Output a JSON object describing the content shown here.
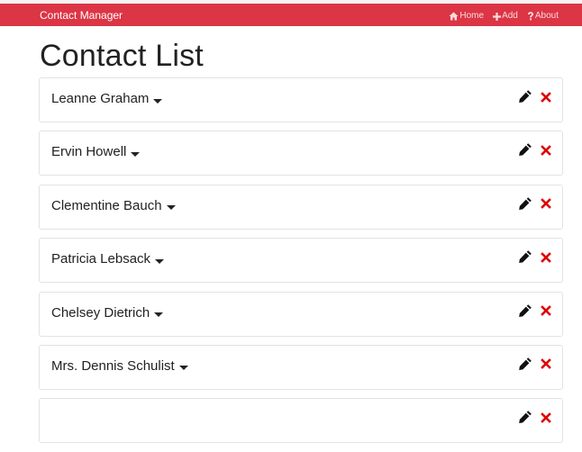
{
  "navbar": {
    "brand": "Contact Manager",
    "links": [
      {
        "label": "Home",
        "icon": "home-icon"
      },
      {
        "label": "Add",
        "icon": "plus-icon"
      },
      {
        "label": "About",
        "icon": "question-icon"
      }
    ],
    "color": "#dc3545"
  },
  "page": {
    "title": "Contact List"
  },
  "contacts": [
    {
      "name": "Leanne Graham"
    },
    {
      "name": "Ervin Howell"
    },
    {
      "name": "Clementine Bauch"
    },
    {
      "name": "Patricia Lebsack"
    },
    {
      "name": "Chelsey Dietrich"
    },
    {
      "name": "Mrs. Dennis Schulist"
    },
    {
      "name": ""
    }
  ],
  "icons": {
    "edit": "pencil-icon",
    "delete": "close-icon",
    "expand": "caret-down-icon"
  },
  "colors": {
    "delete": "#e00000",
    "edit": "#111111"
  }
}
